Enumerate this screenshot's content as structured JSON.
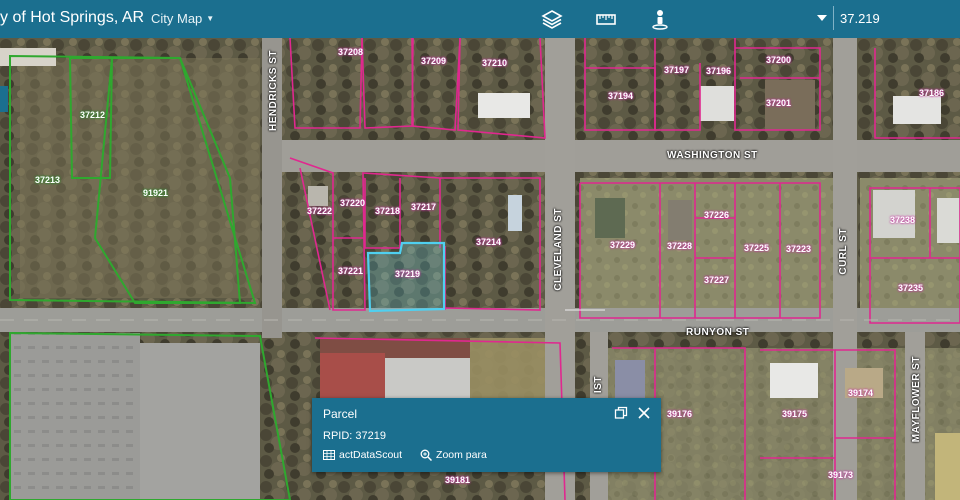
{
  "app": {
    "title": "y of Hot Springs, AR",
    "map_menu_label": "City Map"
  },
  "toolbar": {
    "icons": [
      "layers-icon",
      "measure-icon",
      "street-view-icon"
    ],
    "search_value": "37.219"
  },
  "roads": {
    "washington": "WASHINGTON ST",
    "runyon": "RUNYON ST",
    "cleveland": "CLEVELAND ST",
    "hendricks": "HENDRICKS ST",
    "curl": "CURL ST",
    "mayflower": "MAYFLOWER ST",
    "ist": "IST"
  },
  "parcels": [
    "37208",
    "37209",
    "37210",
    "37212",
    "37213",
    "91921",
    "37197",
    "37196",
    "37200",
    "37194",
    "37201",
    "37186",
    "37222",
    "37220",
    "37218",
    "37217",
    "37214",
    "37221",
    "37219",
    "37229",
    "37226",
    "37228",
    "37225",
    "37223",
    "37227",
    "37238",
    "37235",
    "39176",
    "39175",
    "39174",
    "39173",
    "39181"
  ],
  "popup": {
    "title": "Parcel",
    "content": "RPID: 37219",
    "action1_label": "actDataScout",
    "action2_label": "Zoom para"
  },
  "colors": {
    "header": "#1b6f8f",
    "parcel_line": "#e0288f",
    "zone_line": "#2fa82f",
    "selected": "#4fd0f0"
  }
}
